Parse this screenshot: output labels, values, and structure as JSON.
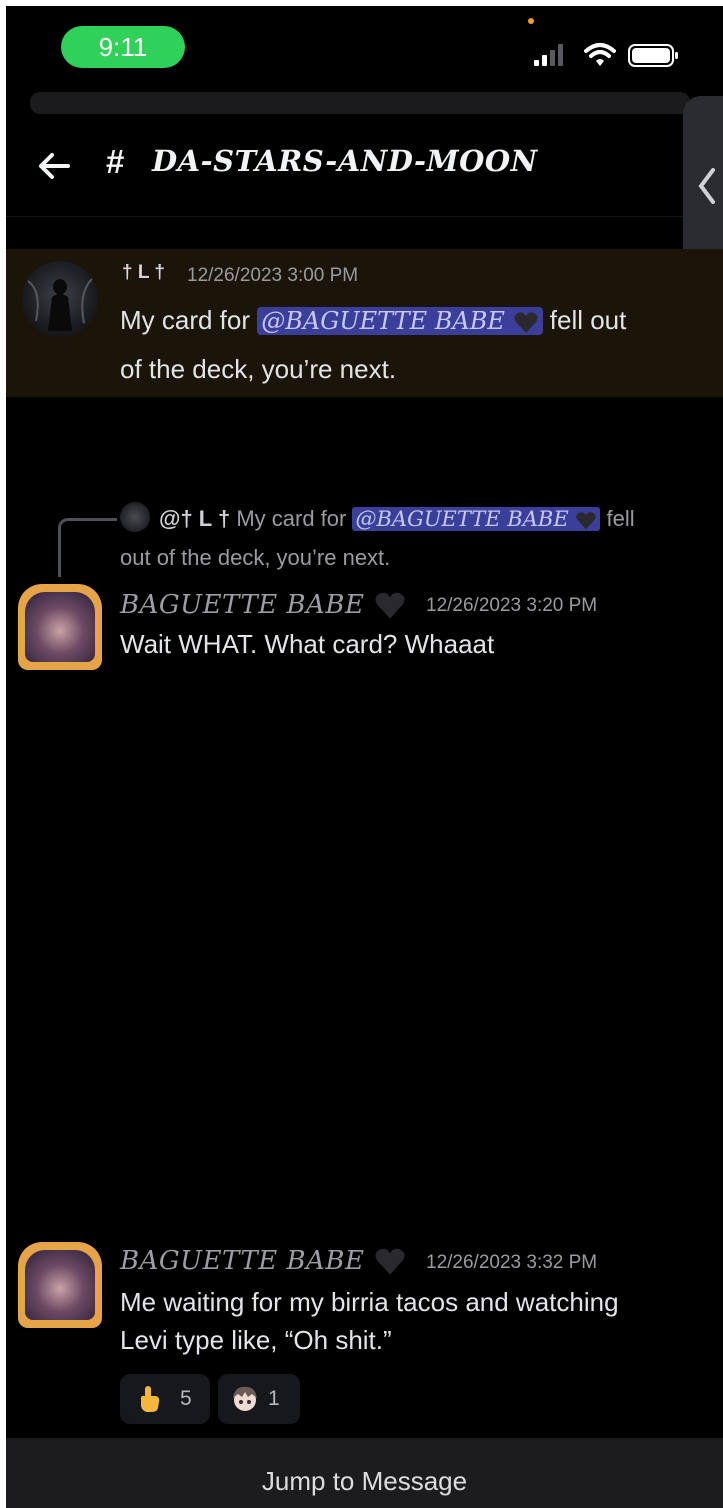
{
  "status": {
    "time": "9:11"
  },
  "header": {
    "hash": "#",
    "channel_name": "DA-STARS-AND-MOON"
  },
  "messages": [
    {
      "author": "† L †",
      "timestamp": "12/26/2023 3:00 PM",
      "text_before": "My card for",
      "mention": "@BAGUETTE BABE",
      "text_after_line1": "fell out",
      "text_line2": "of the deck, you’re next."
    },
    {
      "reply": {
        "author": "@† L †",
        "text_before": "My card for",
        "mention": "@BAGUETTE BABE",
        "text_after": "fell",
        "text_line2": "out of the deck, you’re next."
      },
      "author": "BAGUETTE BABE",
      "timestamp": "12/26/2023 3:20 PM",
      "text": "Wait WHAT. What card? Whaaat"
    },
    {
      "author": "BAGUETTE BABE",
      "timestamp": "12/26/2023 3:32 PM",
      "text_line1": "Me waiting for my birria tacos and watching",
      "text_line2": "Levi type like, “Oh shit.”",
      "reactions": [
        {
          "emoji": "pointing-finger",
          "count": "5"
        },
        {
          "emoji": "anime-face",
          "count": "1"
        }
      ]
    }
  ],
  "footer": {
    "jump_label": "Jump to Message"
  },
  "colors": {
    "accent_green": "#2fd158",
    "mention_bg": "#3b3f99",
    "highlight_bg": "#1a1508"
  }
}
